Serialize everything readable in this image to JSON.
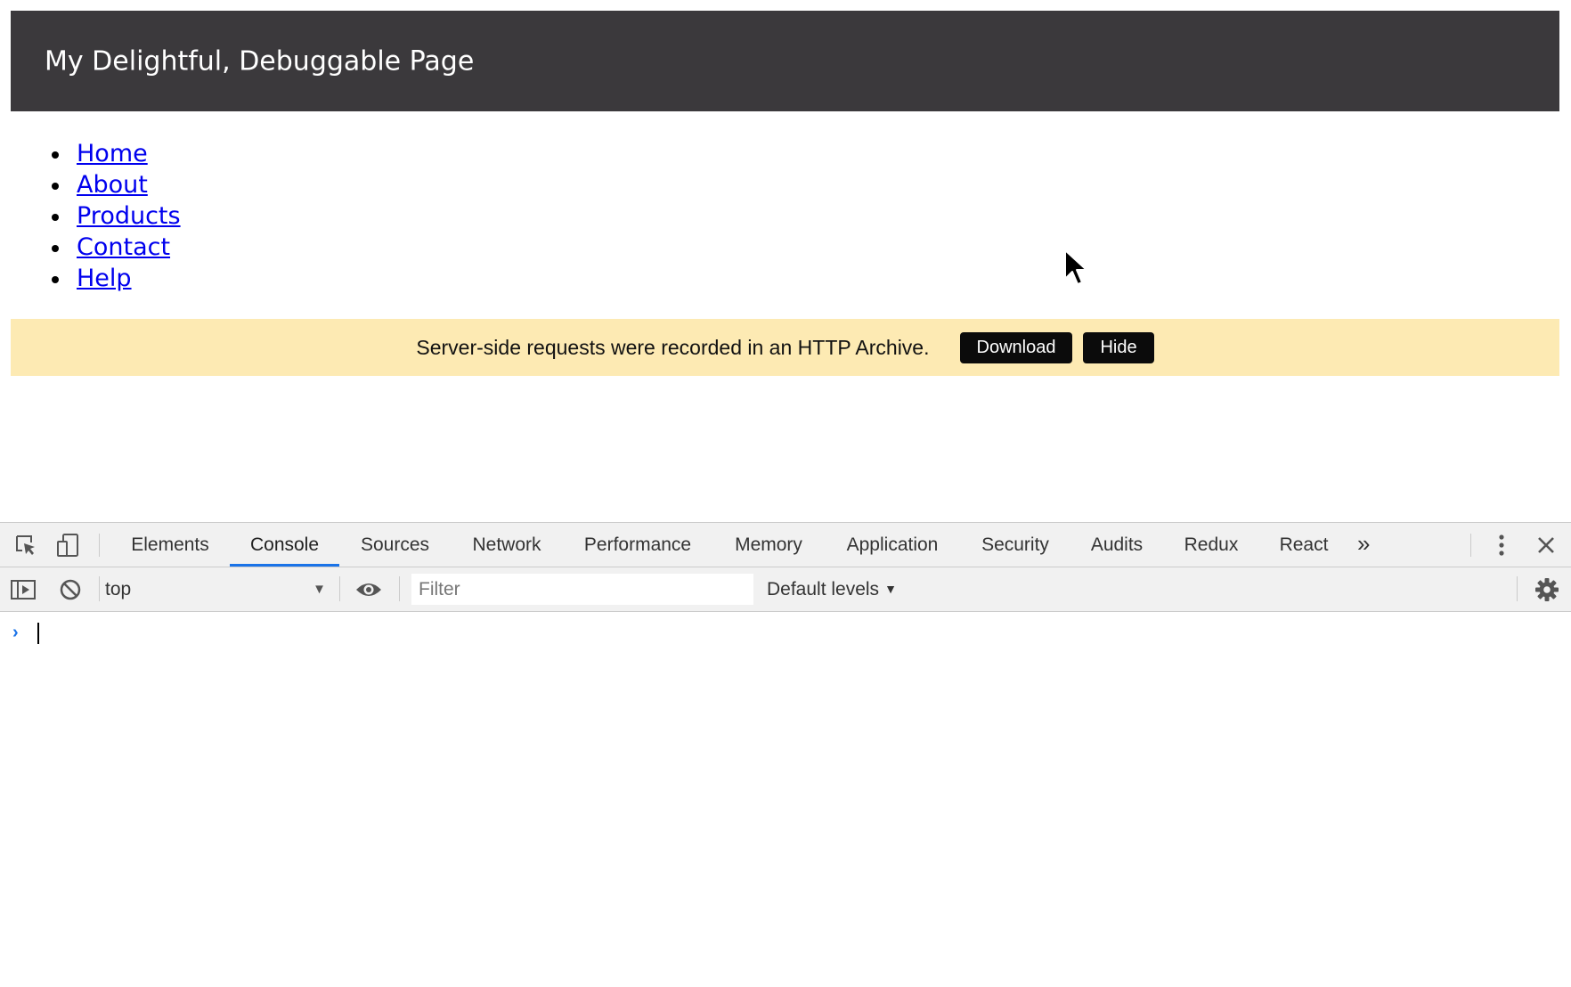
{
  "page": {
    "title": "My Delightful, Debuggable Page",
    "nav": [
      {
        "label": "Home"
      },
      {
        "label": "About"
      },
      {
        "label": "Products"
      },
      {
        "label": "Contact"
      },
      {
        "label": "Help"
      }
    ],
    "notice": {
      "text": "Server-side requests were recorded in an HTTP Archive.",
      "download_label": "Download",
      "hide_label": "Hide",
      "background": "#fdeab3"
    },
    "header_color": "#3b393c",
    "link_color": "#0000ee"
  },
  "devtools": {
    "tabs": [
      {
        "label": "Elements"
      },
      {
        "label": "Console"
      },
      {
        "label": "Sources"
      },
      {
        "label": "Network"
      },
      {
        "label": "Performance"
      },
      {
        "label": "Memory"
      },
      {
        "label": "Application"
      },
      {
        "label": "Security"
      },
      {
        "label": "Audits"
      },
      {
        "label": "Redux"
      },
      {
        "label": "React"
      }
    ],
    "active_tab": "Console",
    "more_tabs_glyph": "»",
    "accent_color": "#1a73e8",
    "icons": {
      "inspect": "inspect-element-icon",
      "device": "device-toolbar-icon",
      "kebab": "kebab-menu-icon",
      "close": "close-icon",
      "sidebar": "show-sidebar-icon",
      "clear": "clear-console-icon",
      "eye": "live-expression-eye-icon",
      "gear": "gear-icon"
    },
    "console": {
      "context": "top",
      "filter_placeholder": "Filter",
      "filter_value": "",
      "levels_label": "Default levels",
      "prompt_glyph": "›"
    }
  }
}
